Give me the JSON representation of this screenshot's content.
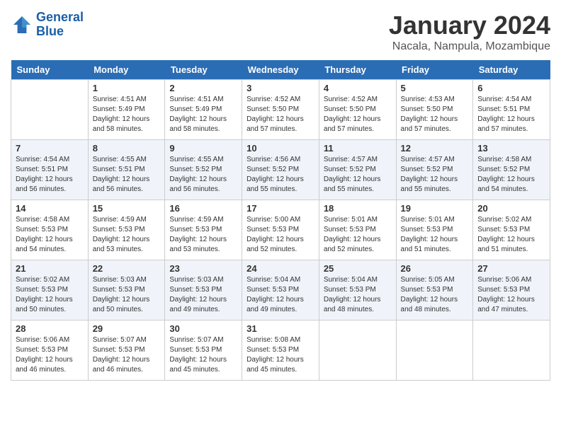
{
  "header": {
    "logo_line1": "General",
    "logo_line2": "Blue",
    "title": "January 2024",
    "subtitle": "Nacala, Nampula, Mozambique"
  },
  "weekdays": [
    "Sunday",
    "Monday",
    "Tuesday",
    "Wednesday",
    "Thursday",
    "Friday",
    "Saturday"
  ],
  "weeks": [
    [
      {
        "day": "",
        "info": ""
      },
      {
        "day": "1",
        "info": "Sunrise: 4:51 AM\nSunset: 5:49 PM\nDaylight: 12 hours\nand 58 minutes."
      },
      {
        "day": "2",
        "info": "Sunrise: 4:51 AM\nSunset: 5:49 PM\nDaylight: 12 hours\nand 58 minutes."
      },
      {
        "day": "3",
        "info": "Sunrise: 4:52 AM\nSunset: 5:50 PM\nDaylight: 12 hours\nand 57 minutes."
      },
      {
        "day": "4",
        "info": "Sunrise: 4:52 AM\nSunset: 5:50 PM\nDaylight: 12 hours\nand 57 minutes."
      },
      {
        "day": "5",
        "info": "Sunrise: 4:53 AM\nSunset: 5:50 PM\nDaylight: 12 hours\nand 57 minutes."
      },
      {
        "day": "6",
        "info": "Sunrise: 4:54 AM\nSunset: 5:51 PM\nDaylight: 12 hours\nand 57 minutes."
      }
    ],
    [
      {
        "day": "7",
        "info": "Sunrise: 4:54 AM\nSunset: 5:51 PM\nDaylight: 12 hours\nand 56 minutes."
      },
      {
        "day": "8",
        "info": "Sunrise: 4:55 AM\nSunset: 5:51 PM\nDaylight: 12 hours\nand 56 minutes."
      },
      {
        "day": "9",
        "info": "Sunrise: 4:55 AM\nSunset: 5:52 PM\nDaylight: 12 hours\nand 56 minutes."
      },
      {
        "day": "10",
        "info": "Sunrise: 4:56 AM\nSunset: 5:52 PM\nDaylight: 12 hours\nand 55 minutes."
      },
      {
        "day": "11",
        "info": "Sunrise: 4:57 AM\nSunset: 5:52 PM\nDaylight: 12 hours\nand 55 minutes."
      },
      {
        "day": "12",
        "info": "Sunrise: 4:57 AM\nSunset: 5:52 PM\nDaylight: 12 hours\nand 55 minutes."
      },
      {
        "day": "13",
        "info": "Sunrise: 4:58 AM\nSunset: 5:52 PM\nDaylight: 12 hours\nand 54 minutes."
      }
    ],
    [
      {
        "day": "14",
        "info": "Sunrise: 4:58 AM\nSunset: 5:53 PM\nDaylight: 12 hours\nand 54 minutes."
      },
      {
        "day": "15",
        "info": "Sunrise: 4:59 AM\nSunset: 5:53 PM\nDaylight: 12 hours\nand 53 minutes."
      },
      {
        "day": "16",
        "info": "Sunrise: 4:59 AM\nSunset: 5:53 PM\nDaylight: 12 hours\nand 53 minutes."
      },
      {
        "day": "17",
        "info": "Sunrise: 5:00 AM\nSunset: 5:53 PM\nDaylight: 12 hours\nand 52 minutes."
      },
      {
        "day": "18",
        "info": "Sunrise: 5:01 AM\nSunset: 5:53 PM\nDaylight: 12 hours\nand 52 minutes."
      },
      {
        "day": "19",
        "info": "Sunrise: 5:01 AM\nSunset: 5:53 PM\nDaylight: 12 hours\nand 51 minutes."
      },
      {
        "day": "20",
        "info": "Sunrise: 5:02 AM\nSunset: 5:53 PM\nDaylight: 12 hours\nand 51 minutes."
      }
    ],
    [
      {
        "day": "21",
        "info": "Sunrise: 5:02 AM\nSunset: 5:53 PM\nDaylight: 12 hours\nand 50 minutes."
      },
      {
        "day": "22",
        "info": "Sunrise: 5:03 AM\nSunset: 5:53 PM\nDaylight: 12 hours\nand 50 minutes."
      },
      {
        "day": "23",
        "info": "Sunrise: 5:03 AM\nSunset: 5:53 PM\nDaylight: 12 hours\nand 49 minutes."
      },
      {
        "day": "24",
        "info": "Sunrise: 5:04 AM\nSunset: 5:53 PM\nDaylight: 12 hours\nand 49 minutes."
      },
      {
        "day": "25",
        "info": "Sunrise: 5:04 AM\nSunset: 5:53 PM\nDaylight: 12 hours\nand 48 minutes."
      },
      {
        "day": "26",
        "info": "Sunrise: 5:05 AM\nSunset: 5:53 PM\nDaylight: 12 hours\nand 48 minutes."
      },
      {
        "day": "27",
        "info": "Sunrise: 5:06 AM\nSunset: 5:53 PM\nDaylight: 12 hours\nand 47 minutes."
      }
    ],
    [
      {
        "day": "28",
        "info": "Sunrise: 5:06 AM\nSunset: 5:53 PM\nDaylight: 12 hours\nand 46 minutes."
      },
      {
        "day": "29",
        "info": "Sunrise: 5:07 AM\nSunset: 5:53 PM\nDaylight: 12 hours\nand 46 minutes."
      },
      {
        "day": "30",
        "info": "Sunrise: 5:07 AM\nSunset: 5:53 PM\nDaylight: 12 hours\nand 45 minutes."
      },
      {
        "day": "31",
        "info": "Sunrise: 5:08 AM\nSunset: 5:53 PM\nDaylight: 12 hours\nand 45 minutes."
      },
      {
        "day": "",
        "info": ""
      },
      {
        "day": "",
        "info": ""
      },
      {
        "day": "",
        "info": ""
      }
    ]
  ]
}
